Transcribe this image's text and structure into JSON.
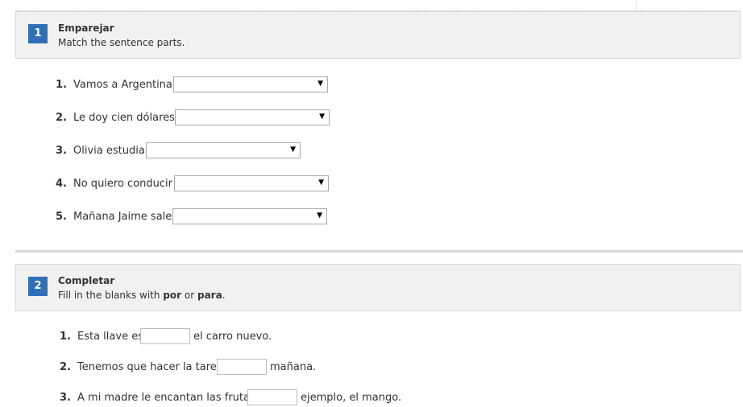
{
  "section1": {
    "number": "1",
    "title": "Emparejar",
    "instruction": "Match the sentence parts.",
    "items": [
      {
        "num": "1.",
        "stem": "Vamos a Argentina",
        "selected": ""
      },
      {
        "num": "2.",
        "stem": "Le doy cien dólares",
        "selected": ""
      },
      {
        "num": "3.",
        "stem": "Olivia estudia",
        "selected": ""
      },
      {
        "num": "4.",
        "stem": "No quiero conducir",
        "selected": ""
      },
      {
        "num": "5.",
        "stem": "Mañana Jaime sale",
        "selected": ""
      }
    ]
  },
  "section2": {
    "number": "2",
    "title": "Completar",
    "instruction_prefix": "Fill in the blanks with ",
    "instruction_word1": "por",
    "instruction_mid": " or ",
    "instruction_word2": "para",
    "instruction_suffix": ".",
    "items": [
      {
        "num": "1.",
        "before": "Esta llave es",
        "after": "el carro nuevo.",
        "value": ""
      },
      {
        "num": "2.",
        "before": "Tenemos que hacer la tarea",
        "after": "mañana.",
        "value": ""
      },
      {
        "num": "3.",
        "before": "A mi madre le encantan las frutas,",
        "after": "ejemplo, el mango.",
        "value": ""
      }
    ]
  },
  "icons": {
    "dropdown_arrow": "▼"
  },
  "colors": {
    "badge": "#2f6fb7",
    "header_bg": "#f1f1f1"
  }
}
